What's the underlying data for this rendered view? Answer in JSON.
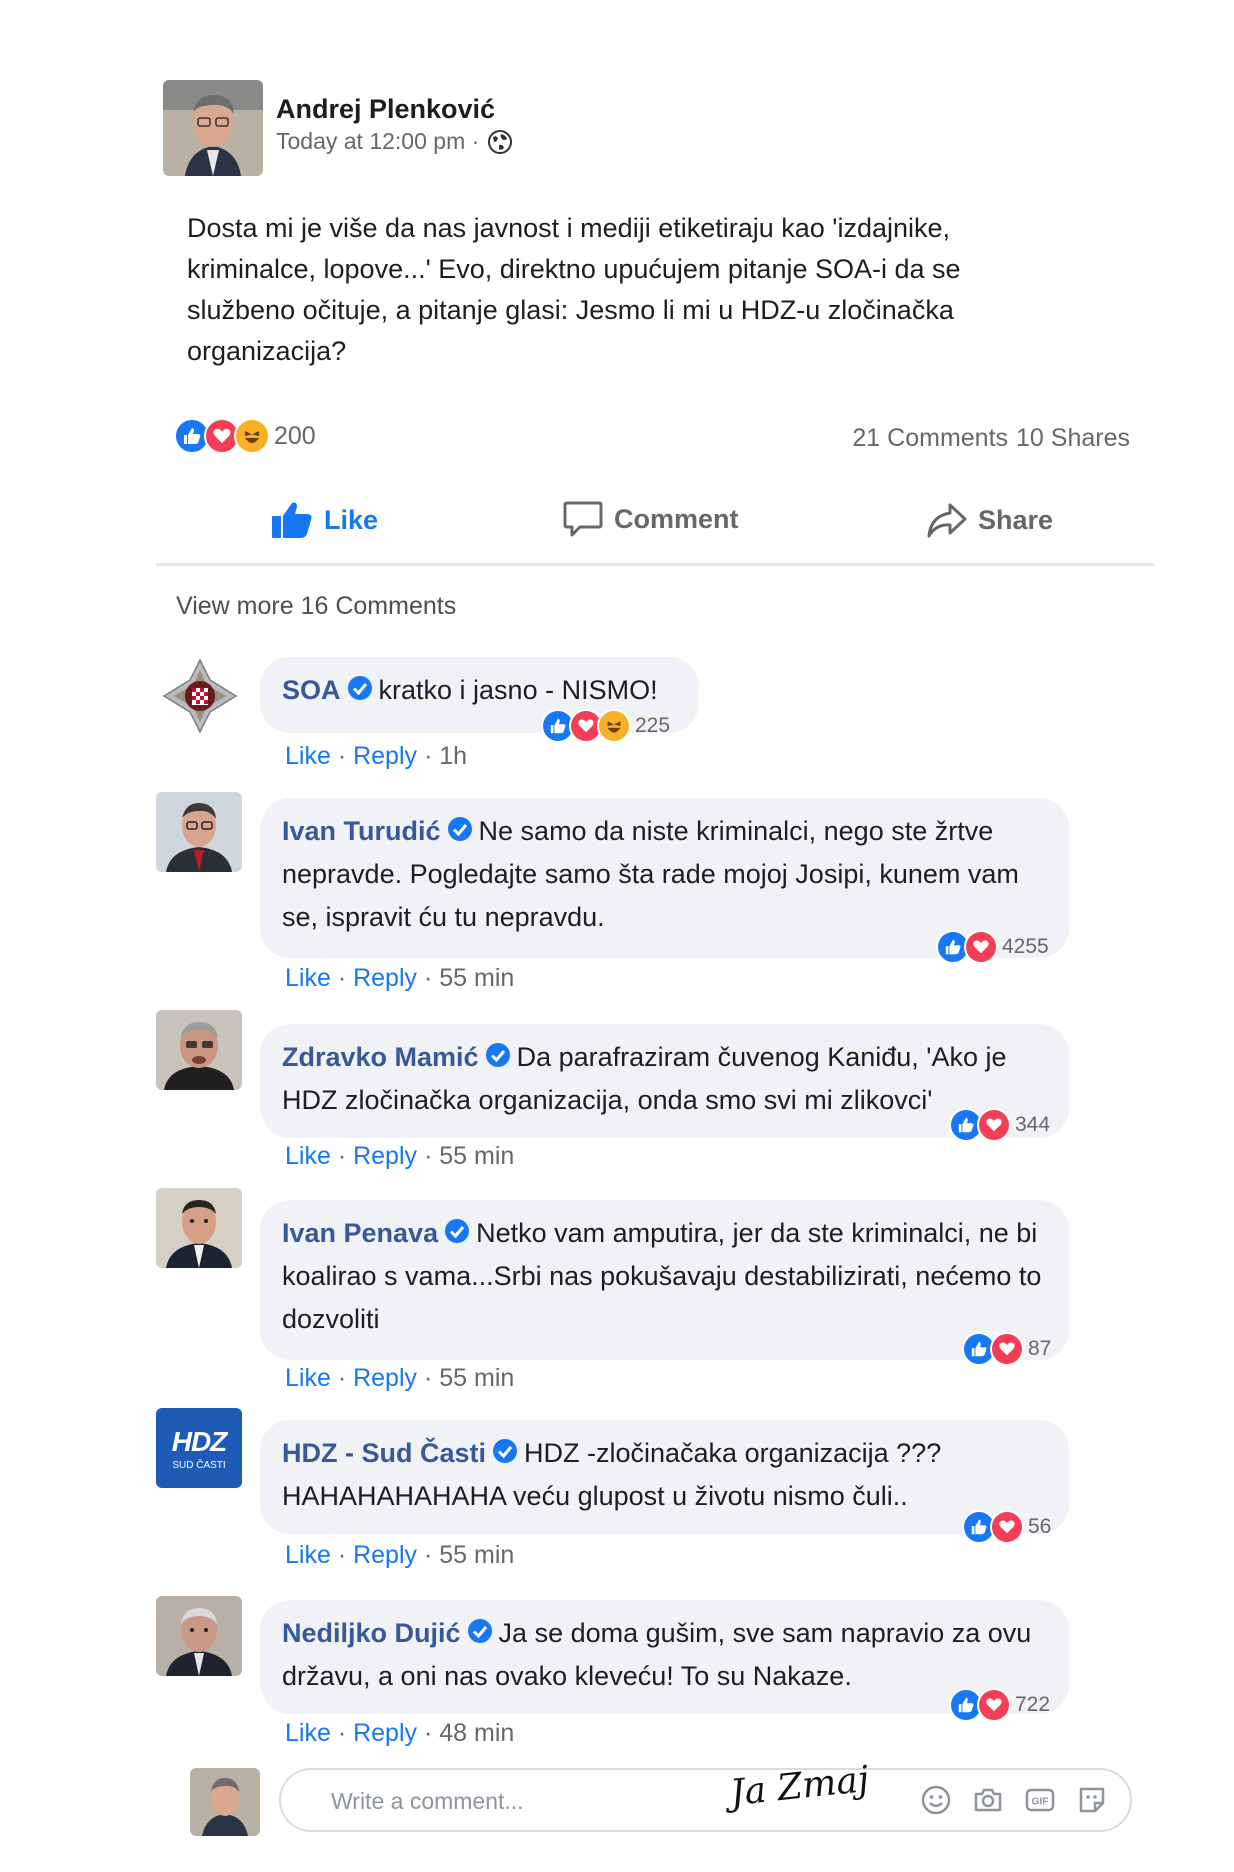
{
  "post": {
    "author": "Andrej Plenković",
    "time": "Today at 12:00 pm ·",
    "audience_icon": "globe-icon",
    "text": "Dosta mi je više da nas javnost i mediji etiketiraju kao 'izdajnike, kriminalce, lopove...' Evo, direktno upućujem pitanje SOA-i da se službeno očituje, a pitanje glasi: Jesmo li mi u HDZ-u zločinačka organizacija?",
    "reaction_count": "200",
    "comments_count": "21 Comments",
    "shares_count": "10 Shares"
  },
  "actions": {
    "like": "Like",
    "comment": "Comment",
    "share": "Share"
  },
  "view_more": "View more 16 Comments",
  "comment_meta": {
    "like": "Like",
    "reply": "Reply"
  },
  "comments": [
    {
      "name": "SOA",
      "text": "kratko i jasno - NISMO!",
      "reactions": "225",
      "time": "1h"
    },
    {
      "name": "Ivan Turudić",
      "text": "Ne samo da niste kriminalci, nego ste žrtve nepravde. Pogledajte samo šta rade mojoj Josipi, kunem vam se, ispravit ću tu nepravdu.",
      "reactions": "4255",
      "time": "55 min"
    },
    {
      "name": "Zdravko Mamić",
      "text": "Da parafraziram čuvenog Kaniđu, 'Ako je HDZ zločinačka organizacija, onda smo svi mi zlikovci'",
      "reactions": "344",
      "time": "55 min"
    },
    {
      "name": "Ivan Penava",
      "text": "Netko vam amputira, jer da ste kriminalci, ne bi koalirao s vama...Srbi nas pokušavaju destabilizirati, nećemo to dozvoliti",
      "reactions": "87",
      "time": "55 min"
    },
    {
      "name": "HDZ - Sud Časti",
      "text": "HDZ -zločinačaka organizacija ??? HAHAHAHAHAHA veću glupost u životu nismo čuli..",
      "reactions": "56",
      "time": "55 min"
    },
    {
      "name": "Nediljko Dujić",
      "text": "Ja se doma gušim, sve sam napravio za ovu državu, a oni nas ovako kleveću! To su Nakaze.",
      "reactions": "722",
      "time": "48 min"
    }
  ],
  "hdz_logo": {
    "big": "HDZ",
    "small": "SUD ČASTI"
  },
  "composer": {
    "placeholder": "Write a comment...",
    "icons": [
      "emoji-icon",
      "camera-icon",
      "gif-icon",
      "sticker-icon"
    ]
  },
  "signature": "Ja Zmaj",
  "colors": {
    "link": "#385898",
    "accent": "#1877f2",
    "like": "#1877f2",
    "love": "#f33e58",
    "haha": "#f7b125",
    "bubble": "#f0f2f5",
    "hdz_blue": "#1d5bb7"
  }
}
